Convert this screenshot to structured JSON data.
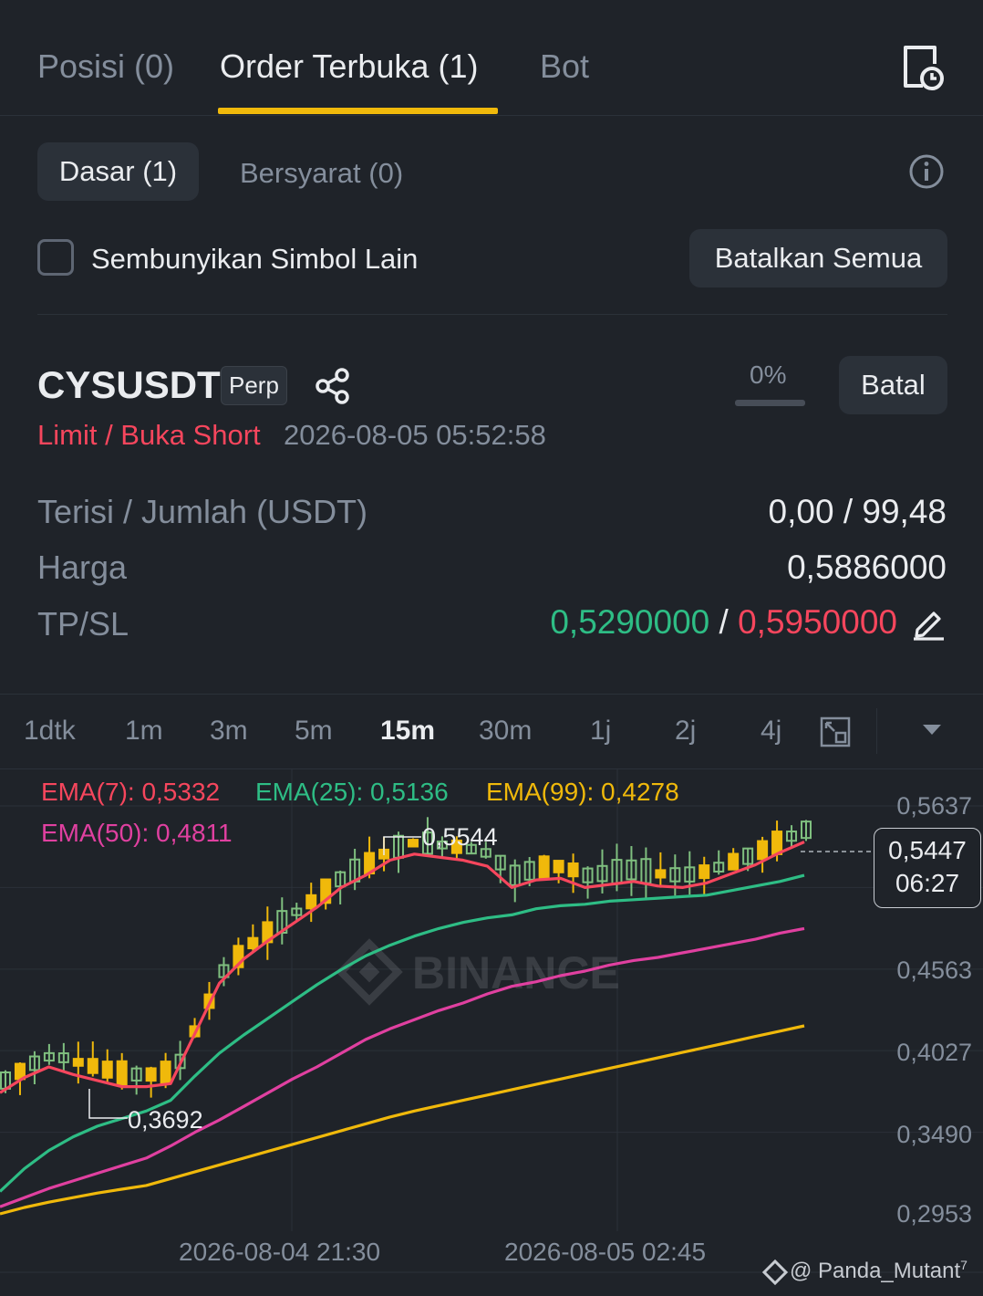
{
  "tabs": [
    {
      "label": "Posisi (0)",
      "active": false
    },
    {
      "label": "Order Terbuka (1)",
      "active": true
    },
    {
      "label": "Bot",
      "active": false
    }
  ],
  "subtabs": {
    "basic": "Dasar (1)",
    "conditional": "Bersyarat (0)"
  },
  "hide_other_symbols": {
    "label": "Sembunyikan Simbol Lain",
    "checked": false
  },
  "cancel_all_label": "Batalkan Semua",
  "order": {
    "symbol": "CYSUSDT",
    "badge": "Perp",
    "type": "Limit / Buka Short",
    "time": "2026-08-05 05:52:58",
    "fill_percent": "0%",
    "cancel_label": "Batal",
    "rows": {
      "filled_label": "Terisi / Jumlah (USDT)",
      "filled_value": "0,00 / 99,48",
      "price_label": "Harga",
      "price_value": "0,5886000",
      "tpsl_label": "TP/SL",
      "tp_value": "0,5290000",
      "sep": "/",
      "sl_value": "0,5950000"
    }
  },
  "timeframes": [
    "1dtk",
    "1m",
    "3m",
    "5m",
    "15m",
    "30m",
    "1j",
    "2j",
    "4j"
  ],
  "active_timeframe": "15m",
  "chart_data": {
    "type": "line",
    "ema": [
      {
        "name": "EMA(7): 0,5332",
        "color": "#f6465d"
      },
      {
        "name": "EMA(25): 0,5136",
        "color": "#2ebd85"
      },
      {
        "name": "EMA(99): 0,4278",
        "color": "#f0b90b"
      },
      {
        "name": "EMA(50): 0,4811",
        "color": "#e040a0"
      }
    ],
    "y_ticks": [
      "0,5637",
      "0,4563",
      "0,4027",
      "0,3490",
      "0,2953"
    ],
    "y_tick_values": [
      0.5637,
      0.4563,
      0.4027,
      0.349,
      0.2953
    ],
    "x_ticks": [
      "2026-08-04 21:30",
      "2026-08-05 02:45"
    ],
    "high_label": "0,5544",
    "low_label": "0,3692",
    "current_price": "0,5447",
    "countdown": "06:27",
    "watermark": "BINANCE",
    "series": [
      {
        "name": "EMA(7)",
        "values": [
          0.375,
          0.385,
          0.392,
          0.387,
          0.383,
          0.379,
          0.379,
          0.381,
          0.414,
          0.447,
          0.463,
          0.475,
          0.486,
          0.497,
          0.51,
          0.518,
          0.528,
          0.532,
          0.53,
          0.528,
          0.524,
          0.51,
          0.515,
          0.516,
          0.51,
          0.512,
          0.514,
          0.511,
          0.51,
          0.513,
          0.519,
          0.525,
          0.533,
          0.54
        ]
      },
      {
        "name": "EMA(25)",
        "values": [
          0.31,
          0.325,
          0.337,
          0.346,
          0.353,
          0.358,
          0.363,
          0.37,
          0.386,
          0.401,
          0.413,
          0.424,
          0.435,
          0.446,
          0.456,
          0.465,
          0.472,
          0.478,
          0.483,
          0.487,
          0.49,
          0.492,
          0.496,
          0.498,
          0.499,
          0.501,
          0.502,
          0.503,
          0.504,
          0.505,
          0.508,
          0.511,
          0.514,
          0.518
        ]
      },
      {
        "name": "EMA(50)",
        "values": [
          0.3,
          0.306,
          0.312,
          0.317,
          0.322,
          0.327,
          0.332,
          0.34,
          0.349,
          0.357,
          0.366,
          0.375,
          0.384,
          0.392,
          0.401,
          0.41,
          0.417,
          0.423,
          0.429,
          0.434,
          0.44,
          0.445,
          0.448,
          0.452,
          0.455,
          0.459,
          0.462,
          0.464,
          0.467,
          0.47,
          0.473,
          0.476,
          0.48,
          0.483
        ]
      },
      {
        "name": "EMA(99)",
        "values": [
          0.2953,
          0.2995,
          0.303,
          0.306,
          0.309,
          0.3115,
          0.314,
          0.3185,
          0.323,
          0.3275,
          0.332,
          0.3365,
          0.341,
          0.3455,
          0.35,
          0.3545,
          0.359,
          0.363,
          0.3665,
          0.37,
          0.3735,
          0.377,
          0.3805,
          0.384,
          0.3875,
          0.391,
          0.3945,
          0.398,
          0.4015,
          0.405,
          0.4085,
          0.412,
          0.4155,
          0.419
        ]
      }
    ]
  },
  "watermark_user": "@ Panda_Mutant",
  "superscript": "7"
}
